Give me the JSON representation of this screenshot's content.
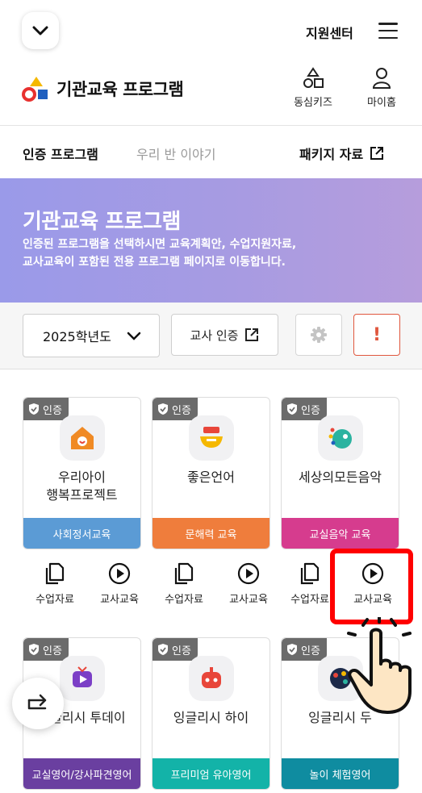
{
  "header": {
    "support_label": "지원센터"
  },
  "brand": {
    "title": "기관교육 프로그램",
    "nav": [
      {
        "label": "동심키즈",
        "icon": "shapes-icon"
      },
      {
        "label": "마이홈",
        "icon": "user-icon"
      }
    ]
  },
  "tabs": {
    "certified": "인증 프로그램",
    "class_story": "우리 반 이야기",
    "package": "패키지 자료"
  },
  "banner": {
    "title": "기관교육 프로그램",
    "line1": "인증된 프로그램을 선택하시면 교육계획안, 수업지원자료,",
    "line2": "교사교육이 포함된 전용 프로그램 페이지로 이동합니다."
  },
  "controls": {
    "year": "2025학년도",
    "teacher_auth": "교사 인증",
    "alert": "!"
  },
  "badge_label": "인증",
  "cards": [
    {
      "name1": "우리아이",
      "name2": "행복프로젝트",
      "category": "사회정서교육",
      "color": "#5b9bd5"
    },
    {
      "name1": "좋은언어",
      "name2": "",
      "category": "문해력 교육",
      "color": "#ef7d3c"
    },
    {
      "name1": "세상의모든음악",
      "name2": "",
      "category": "교실음악 교육",
      "color": "#d63c8e"
    },
    {
      "name1": "잉글리시 투데이",
      "name2": "",
      "category": "교실영어/강사파견영어",
      "color": "#6a3fa0"
    },
    {
      "name1": "잉글리시 하이",
      "name2": "",
      "category": "프리미엄 유아영어",
      "color": "#13b3a8"
    },
    {
      "name1": "잉글리시 두",
      "name2": "",
      "category": "놀이 체험영어",
      "color": "#0f8ca0"
    }
  ],
  "actions": {
    "material": "수업자료",
    "teacher_edu": "교사교육"
  }
}
